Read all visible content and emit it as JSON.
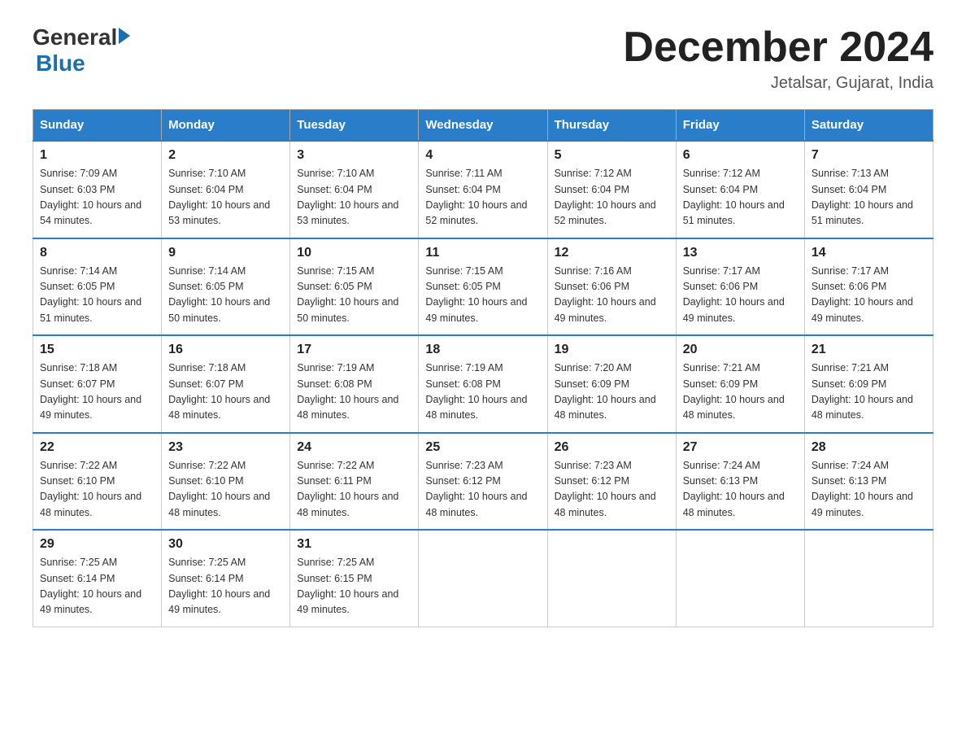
{
  "logo": {
    "general": "General",
    "blue": "Blue"
  },
  "header": {
    "month": "December 2024",
    "location": "Jetalsar, Gujarat, India"
  },
  "weekdays": [
    "Sunday",
    "Monday",
    "Tuesday",
    "Wednesday",
    "Thursday",
    "Friday",
    "Saturday"
  ],
  "weeks": [
    [
      {
        "day": "1",
        "sunrise": "7:09 AM",
        "sunset": "6:03 PM",
        "daylight": "10 hours and 54 minutes."
      },
      {
        "day": "2",
        "sunrise": "7:10 AM",
        "sunset": "6:04 PM",
        "daylight": "10 hours and 53 minutes."
      },
      {
        "day": "3",
        "sunrise": "7:10 AM",
        "sunset": "6:04 PM",
        "daylight": "10 hours and 53 minutes."
      },
      {
        "day": "4",
        "sunrise": "7:11 AM",
        "sunset": "6:04 PM",
        "daylight": "10 hours and 52 minutes."
      },
      {
        "day": "5",
        "sunrise": "7:12 AM",
        "sunset": "6:04 PM",
        "daylight": "10 hours and 52 minutes."
      },
      {
        "day": "6",
        "sunrise": "7:12 AM",
        "sunset": "6:04 PM",
        "daylight": "10 hours and 51 minutes."
      },
      {
        "day": "7",
        "sunrise": "7:13 AM",
        "sunset": "6:04 PM",
        "daylight": "10 hours and 51 minutes."
      }
    ],
    [
      {
        "day": "8",
        "sunrise": "7:14 AM",
        "sunset": "6:05 PM",
        "daylight": "10 hours and 51 minutes."
      },
      {
        "day": "9",
        "sunrise": "7:14 AM",
        "sunset": "6:05 PM",
        "daylight": "10 hours and 50 minutes."
      },
      {
        "day": "10",
        "sunrise": "7:15 AM",
        "sunset": "6:05 PM",
        "daylight": "10 hours and 50 minutes."
      },
      {
        "day": "11",
        "sunrise": "7:15 AM",
        "sunset": "6:05 PM",
        "daylight": "10 hours and 49 minutes."
      },
      {
        "day": "12",
        "sunrise": "7:16 AM",
        "sunset": "6:06 PM",
        "daylight": "10 hours and 49 minutes."
      },
      {
        "day": "13",
        "sunrise": "7:17 AM",
        "sunset": "6:06 PM",
        "daylight": "10 hours and 49 minutes."
      },
      {
        "day": "14",
        "sunrise": "7:17 AM",
        "sunset": "6:06 PM",
        "daylight": "10 hours and 49 minutes."
      }
    ],
    [
      {
        "day": "15",
        "sunrise": "7:18 AM",
        "sunset": "6:07 PM",
        "daylight": "10 hours and 49 minutes."
      },
      {
        "day": "16",
        "sunrise": "7:18 AM",
        "sunset": "6:07 PM",
        "daylight": "10 hours and 48 minutes."
      },
      {
        "day": "17",
        "sunrise": "7:19 AM",
        "sunset": "6:08 PM",
        "daylight": "10 hours and 48 minutes."
      },
      {
        "day": "18",
        "sunrise": "7:19 AM",
        "sunset": "6:08 PM",
        "daylight": "10 hours and 48 minutes."
      },
      {
        "day": "19",
        "sunrise": "7:20 AM",
        "sunset": "6:09 PM",
        "daylight": "10 hours and 48 minutes."
      },
      {
        "day": "20",
        "sunrise": "7:21 AM",
        "sunset": "6:09 PM",
        "daylight": "10 hours and 48 minutes."
      },
      {
        "day": "21",
        "sunrise": "7:21 AM",
        "sunset": "6:09 PM",
        "daylight": "10 hours and 48 minutes."
      }
    ],
    [
      {
        "day": "22",
        "sunrise": "7:22 AM",
        "sunset": "6:10 PM",
        "daylight": "10 hours and 48 minutes."
      },
      {
        "day": "23",
        "sunrise": "7:22 AM",
        "sunset": "6:10 PM",
        "daylight": "10 hours and 48 minutes."
      },
      {
        "day": "24",
        "sunrise": "7:22 AM",
        "sunset": "6:11 PM",
        "daylight": "10 hours and 48 minutes."
      },
      {
        "day": "25",
        "sunrise": "7:23 AM",
        "sunset": "6:12 PM",
        "daylight": "10 hours and 48 minutes."
      },
      {
        "day": "26",
        "sunrise": "7:23 AM",
        "sunset": "6:12 PM",
        "daylight": "10 hours and 48 minutes."
      },
      {
        "day": "27",
        "sunrise": "7:24 AM",
        "sunset": "6:13 PM",
        "daylight": "10 hours and 48 minutes."
      },
      {
        "day": "28",
        "sunrise": "7:24 AM",
        "sunset": "6:13 PM",
        "daylight": "10 hours and 49 minutes."
      }
    ],
    [
      {
        "day": "29",
        "sunrise": "7:25 AM",
        "sunset": "6:14 PM",
        "daylight": "10 hours and 49 minutes."
      },
      {
        "day": "30",
        "sunrise": "7:25 AM",
        "sunset": "6:14 PM",
        "daylight": "10 hours and 49 minutes."
      },
      {
        "day": "31",
        "sunrise": "7:25 AM",
        "sunset": "6:15 PM",
        "daylight": "10 hours and 49 minutes."
      },
      null,
      null,
      null,
      null
    ]
  ]
}
